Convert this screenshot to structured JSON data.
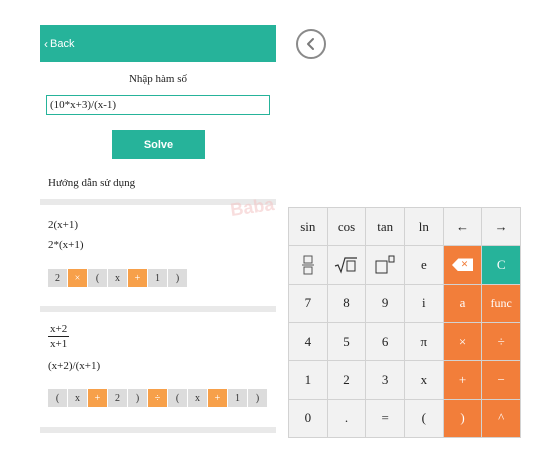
{
  "header": {
    "back_label": "Back"
  },
  "input": {
    "label": "Nhập hàm số",
    "value": "(10*x+3)/(x-1)"
  },
  "solve_label": "Solve",
  "guide_title": "Hướng dẫn sử dụng",
  "examples": [
    {
      "display": "2(x+1)",
      "typed": "2*(x+1)",
      "chips": [
        "2",
        "×",
        "(",
        "x",
        "+",
        "1",
        ")"
      ]
    },
    {
      "fraction_num": "x+2",
      "fraction_den": "x+1",
      "typed": "(x+2)/(x+1)",
      "chips": [
        "(",
        "x",
        "+",
        "2",
        ")",
        "÷",
        "(",
        "x",
        "+",
        "1",
        ")"
      ]
    }
  ],
  "watermark": "Baba",
  "keypad": {
    "row1": [
      "sin",
      "cos",
      "tan",
      "ln",
      "←",
      "→"
    ],
    "row2": [
      "fraction-icon",
      "sqrt-icon",
      "power-icon",
      "e",
      "backspace-icon",
      "C"
    ],
    "row3": [
      "7",
      "8",
      "9",
      "i",
      "a",
      "func"
    ],
    "row4": [
      "4",
      "5",
      "6",
      "π",
      "×",
      "÷"
    ],
    "row5": [
      "1",
      "2",
      "3",
      "x",
      "+",
      "−"
    ],
    "row6": [
      "0",
      ".",
      "=",
      "(",
      ")",
      "^"
    ]
  },
  "colors": {
    "teal": "#26b39a",
    "orange": "#f27e3a",
    "chip_orange": "#f7a04a"
  }
}
